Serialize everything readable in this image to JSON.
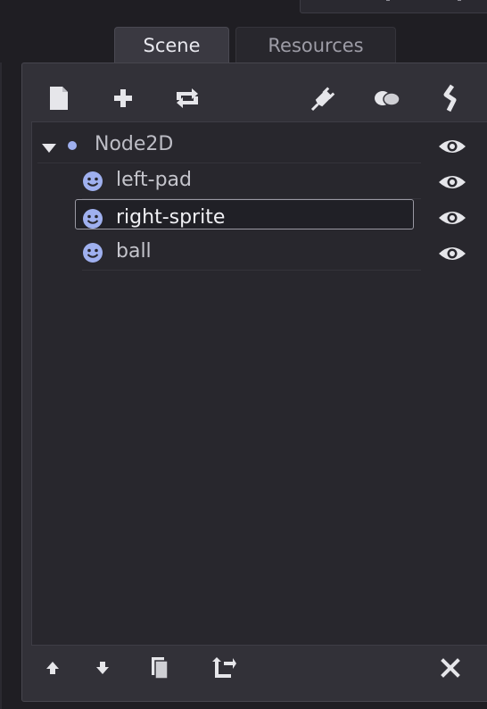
{
  "tabs": [
    {
      "label": "Scene",
      "active": true
    },
    {
      "label": "Resources",
      "active": false
    }
  ],
  "toolbar": {
    "icons": [
      "new-scene-icon",
      "add-node-icon",
      "instance-icon",
      "plug-icon",
      "groups-icon",
      "script-icon"
    ]
  },
  "tree": {
    "root": {
      "label": "Node2D",
      "expanded": true,
      "visible": true
    },
    "children": [
      {
        "label": "left-pad",
        "visible": true,
        "selected": false
      },
      {
        "label": "right-sprite",
        "visible": true,
        "selected": true
      },
      {
        "label": "ball",
        "visible": true,
        "selected": false
      }
    ]
  },
  "bottom_toolbar": {
    "icons": [
      "move-up-icon",
      "move-down-icon",
      "duplicate-icon",
      "reparent-icon",
      "delete-icon"
    ]
  },
  "colors": {
    "background": "#1f1e23",
    "panel": "#323138",
    "tree_background": "#28272d",
    "node_icon": "#9fb0ef",
    "text": "#c5c5cc",
    "icon_white": "#e6e6ea"
  }
}
